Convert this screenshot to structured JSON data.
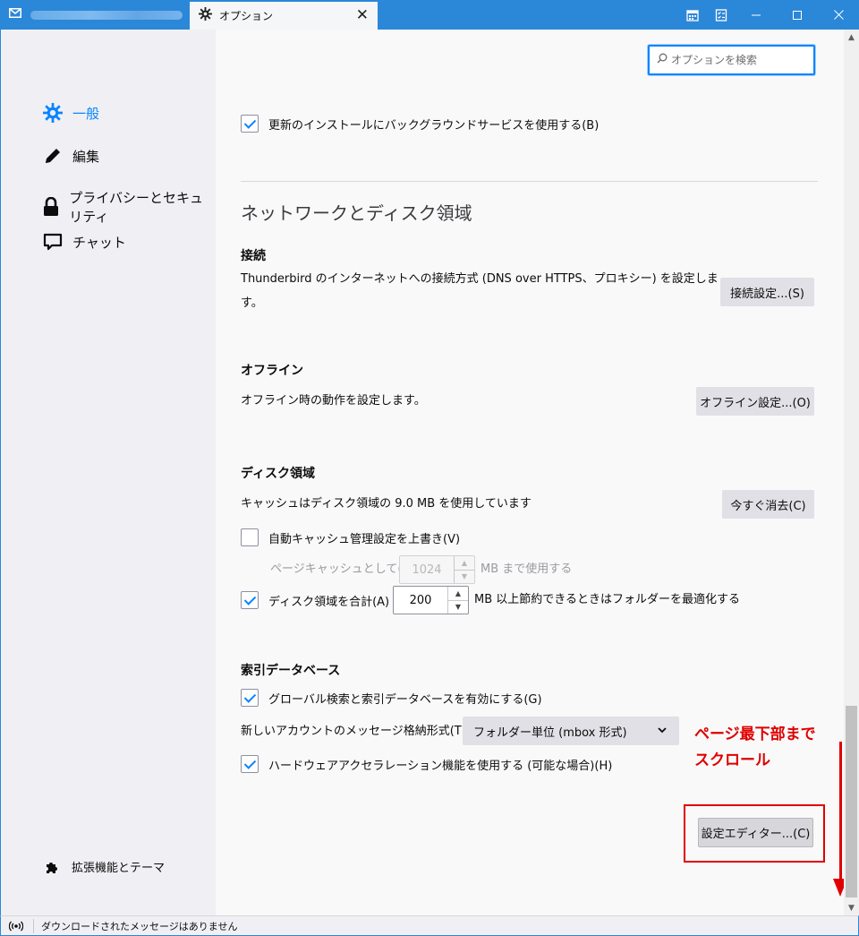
{
  "window": {
    "mail_tab_icon": "mail-icon",
    "options_tab_title": "オプション",
    "close_tab": "✕",
    "controls": [
      "calendar-icon",
      "tasks-icon",
      "minimize-icon",
      "maximize-icon",
      "close-icon"
    ]
  },
  "sidebar": {
    "items": [
      {
        "label": "一般",
        "icon": "gear-icon"
      },
      {
        "label": "編集",
        "icon": "pencil-icon"
      },
      {
        "label": "プライバシーとセキュリティ",
        "icon": "lock-icon"
      },
      {
        "label": "チャット",
        "icon": "chat-icon"
      }
    ],
    "extensions_label": "拡張機能とテーマ"
  },
  "search": {
    "placeholder": "オプションを検索"
  },
  "updates": {
    "bg_service_label": "更新のインストールにバックグラウンドサービスを使用する(B)",
    "bg_service_checked": true
  },
  "network": {
    "section_title": "ネットワークとディスク領域",
    "connection": {
      "title": "接続",
      "description_line1": "Thunderbird のインターネットへの接続方式 (DNS over HTTPS、プロキシー) を設定しま",
      "description_line2": "す。",
      "button": "接続設定...(S)"
    },
    "offline": {
      "title": "オフライン",
      "description": "オフライン時の動作を設定します。",
      "button": "オフライン設定...(O)"
    },
    "disk": {
      "title": "ディスク領域",
      "cache_text": "キャッシュはディスク領域の 9.0 MB を使用しています",
      "clear_button": "今すぐ消去(C)",
      "override_label": "自動キャッシュ管理設定を上書き(V)",
      "override_checked": false,
      "page_cache_label": "ページキャッシュとして(U)",
      "page_cache_value": "1024",
      "page_cache_unit": "MB まで使用する",
      "compact_label": "ディスク領域を合計(A)",
      "compact_checked": true,
      "compact_value": "200",
      "compact_unit": "MB 以上節約できるときはフォルダーを最適化する"
    }
  },
  "index": {
    "title": "索引データベース",
    "global_search_label": "グローバル検索と索引データベースを有効にする(G)",
    "global_search_checked": true,
    "store_type_label": "新しいアカウントのメッセージ格納形式(T):",
    "store_type_value": "フォルダー単位 (mbox 形式)",
    "hw_accel_label": "ハードウェアアクセラレーション機能を使用する (可能な場合)(H)",
    "hw_accel_checked": true,
    "config_editor_button": "設定エディター...(C)"
  },
  "annotation": {
    "line1": "ページ最下部まで",
    "line2": "スクロール",
    "color": "#e00000"
  },
  "status": {
    "text": "ダウンロードされたメッセージはありません"
  },
  "colors": {
    "accent": "#0a84ff",
    "titlebar": "#2b87d8"
  }
}
